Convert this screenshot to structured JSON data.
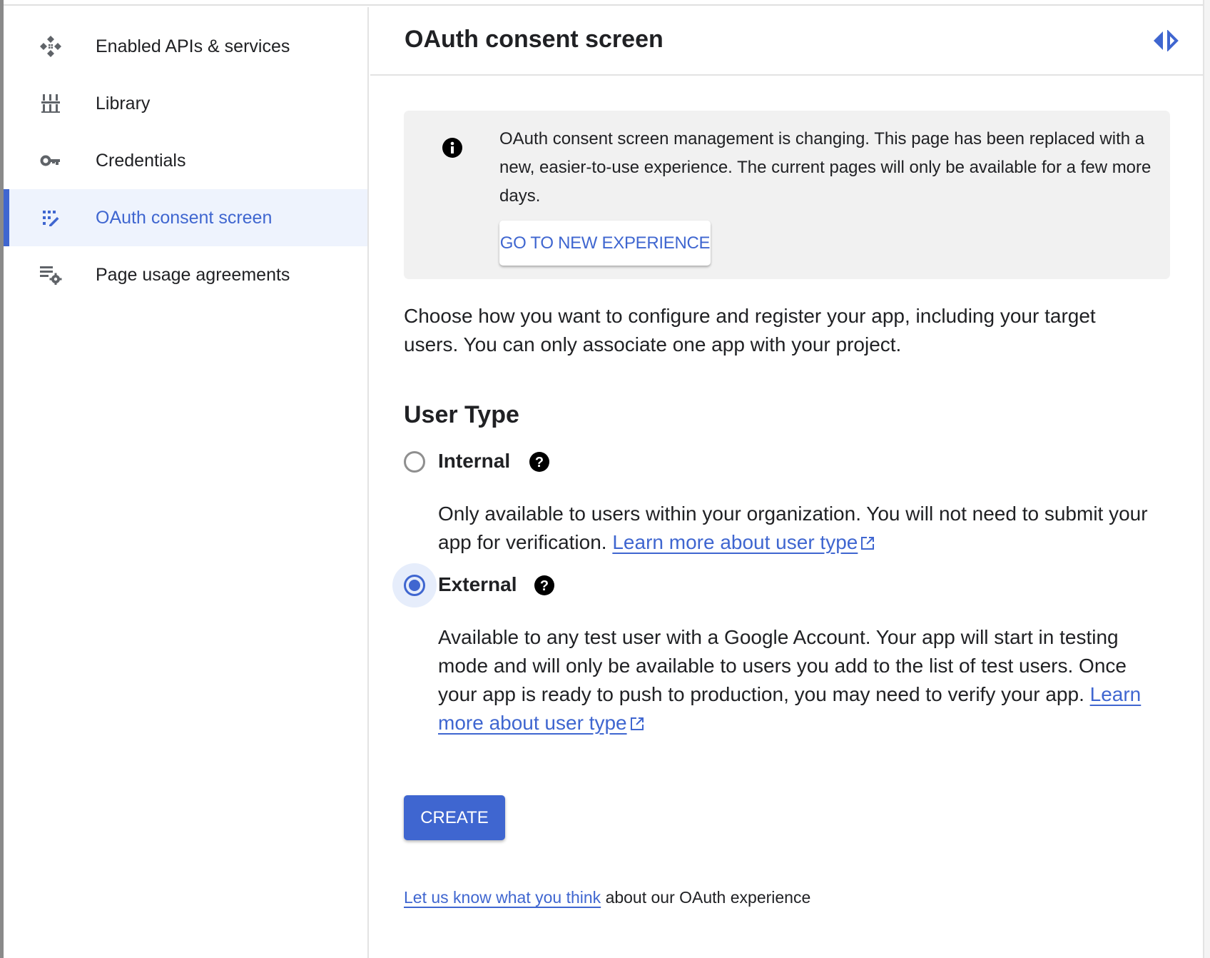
{
  "sidebar": {
    "items": [
      {
        "label": "Enabled APIs & services",
        "icon": "api-diamond-icon",
        "active": false
      },
      {
        "label": "Library",
        "icon": "library-icon",
        "active": false
      },
      {
        "label": "Credentials",
        "icon": "key-icon",
        "active": false
      },
      {
        "label": "OAuth consent screen",
        "icon": "consent-screen-icon",
        "active": true
      },
      {
        "label": "Page usage agreements",
        "icon": "settings-list-icon",
        "active": false
      }
    ]
  },
  "header": {
    "title": "OAuth consent screen",
    "toggle_icon": "panel-toggle-icon"
  },
  "banner": {
    "message": "OAuth consent screen management is changing. This page has been replaced with a new, easier-to-use experience. The current pages will only be available for a few more days.",
    "button_label": "GO TO NEW EXPERIENCE"
  },
  "intro": "Choose how you want to configure and register your app, including your target users. You can only associate one app with your project.",
  "user_type": {
    "heading": "User Type",
    "options": [
      {
        "label": "Internal",
        "checked": false,
        "description": "Only available to users within your organization. You will not need to submit your app for verification.",
        "link": "Learn more about user type"
      },
      {
        "label": "External",
        "checked": true,
        "description": "Available to any test user with a Google Account. Your app will start in testing mode and will only be available to users you add to the list of test users. Once your app is ready to push to production, you may need to verify your app.",
        "link": "Learn more about user type"
      }
    ]
  },
  "create_label": "CREATE",
  "feedback": {
    "link": "Let us know what you think",
    "text": "about our OAuth experience"
  },
  "colors": {
    "accent": "#3f66d0",
    "banner_bg": "#f1f1f1",
    "active_bg": "#eef3fd"
  }
}
